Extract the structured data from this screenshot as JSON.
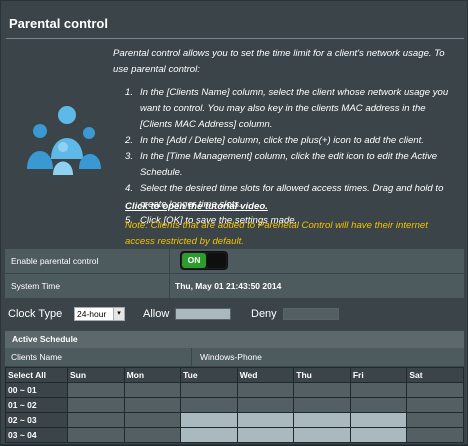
{
  "title": "Parental control",
  "intro": "Parental control allows you to set the time limit for a client's network usage. To use parental control:",
  "steps": [
    {
      "num": "1.",
      "text": "In the [Clients Name] column, select the client whose network usage you want to control. You may also key in the clients MAC address in the [Clients MAC Address] column."
    },
    {
      "num": "2.",
      "text": "In the [Add / Delete] column, click the plus(+) icon to add the client."
    },
    {
      "num": "3.",
      "text": "In the [Time Management] column, click the edit icon to edit the Active Schedule."
    },
    {
      "num": "4.",
      "text": "Select the desired time slots for allowed access times. Drag and hold to create longer time slots."
    },
    {
      "num": "5.",
      "text": "Click [OK] to save the settings made."
    }
  ],
  "tutorial_link": "Click to open the tutorial video.",
  "note": "Note: Clients that are added to Parenetal Control will have their internet access restricted by default.",
  "settings": {
    "enable_label": "Enable parental control",
    "enable_state": "ON",
    "system_time_label": "System Time",
    "system_time_value": "Thu, May 01 21:43:50 2014"
  },
  "clock": {
    "label": "Clock Type",
    "selected": "24-hour",
    "allow_label": "Allow",
    "deny_label": "Deny",
    "allow_color": "#a9b9bd",
    "deny_color": "#535f63"
  },
  "schedule": {
    "header": "Active Schedule",
    "clients_label": "Clients Name",
    "client_value": "Windows-Phone",
    "select_all": "Select All",
    "days": [
      "Sun",
      "Mon",
      "Tue",
      "Wed",
      "Thu",
      "Fri",
      "Sat"
    ],
    "rows": [
      {
        "time": "00 ~ 01",
        "allowed": [
          false,
          false,
          false,
          false,
          false,
          false,
          false
        ]
      },
      {
        "time": "01 ~ 02",
        "allowed": [
          false,
          false,
          false,
          false,
          false,
          false,
          false
        ]
      },
      {
        "time": "02 ~ 03",
        "allowed": [
          false,
          false,
          true,
          true,
          true,
          true,
          false
        ]
      },
      {
        "time": "03 ~ 04",
        "allowed": [
          false,
          false,
          true,
          true,
          true,
          true,
          false
        ]
      }
    ]
  }
}
